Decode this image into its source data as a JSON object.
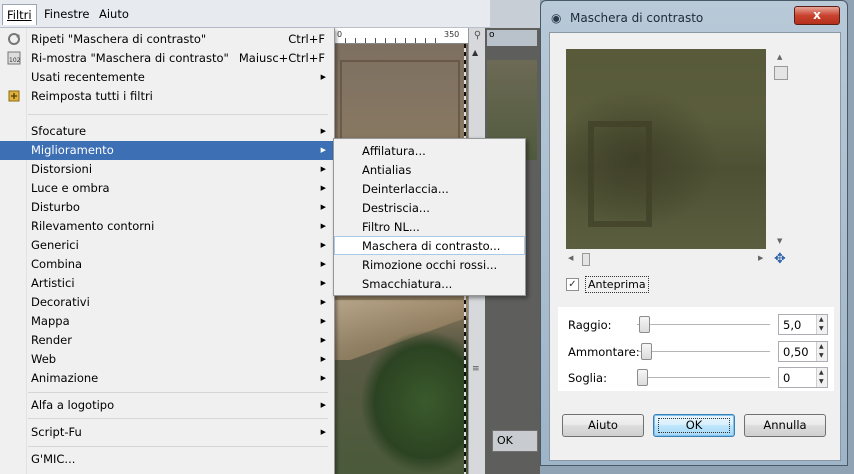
{
  "menubar": {
    "items": [
      "Filtri",
      "Finestre",
      "Aiuto"
    ]
  },
  "ruler": {
    "labels": [
      "0",
      "350"
    ]
  },
  "background_window": {
    "tab_label": "o",
    "ok_label": "OK"
  },
  "filtri_menu": {
    "items": [
      {
        "label": "Ripeti \"Maschera di contrasto\"",
        "accel": "Ctrl+F",
        "icon": "repeat-icon"
      },
      {
        "label": "Ri-mostra \"Maschera di contrasto\"",
        "accel": "Maiusc+Ctrl+F",
        "icon": "reshow-icon"
      },
      {
        "label": "Usati recentemente",
        "submenu": true
      },
      {
        "label": "Reimposta tutti i filtri",
        "icon": "reset-filters-icon"
      },
      {
        "label": "Sfocature",
        "submenu": true
      },
      {
        "label": "Miglioramento",
        "submenu": true,
        "selected": true
      },
      {
        "label": "Distorsioni",
        "submenu": true
      },
      {
        "label": "Luce e ombra",
        "submenu": true
      },
      {
        "label": "Disturbo",
        "submenu": true
      },
      {
        "label": "Rilevamento contorni",
        "submenu": true
      },
      {
        "label": "Generici",
        "submenu": true
      },
      {
        "label": "Combina",
        "submenu": true
      },
      {
        "label": "Artistici",
        "submenu": true
      },
      {
        "label": "Decorativi",
        "submenu": true
      },
      {
        "label": "Mappa",
        "submenu": true
      },
      {
        "label": "Render",
        "submenu": true
      },
      {
        "label": "Web",
        "submenu": true
      },
      {
        "label": "Animazione",
        "submenu": true
      },
      {
        "label": "Alfa a logotipo",
        "submenu": true
      },
      {
        "label": "Script-Fu",
        "submenu": true
      },
      {
        "label": "G'MIC..."
      }
    ]
  },
  "miglioramento_submenu": {
    "items": [
      "Affilatura...",
      "Antialias",
      "Deinterlaccia...",
      "Destriscia...",
      "Filtro NL...",
      "Maschera di contrasto...",
      "Rimozione occhi rossi...",
      "Smacchiatura..."
    ],
    "highlighted": "Maschera di contrasto..."
  },
  "dialog": {
    "title": "Maschera di contrasto",
    "close_label": "x",
    "preview_checkbox": {
      "label": "Anteprima",
      "checked": true
    },
    "params": [
      {
        "label": "Raggio:",
        "value": "5,0",
        "level": 0.02
      },
      {
        "label": "Ammontare:",
        "value": "0,50",
        "level": 0.03
      },
      {
        "label": "Soglia:",
        "value": "0",
        "level": 0.0
      }
    ],
    "buttons": {
      "help": "Aiuto",
      "ok": "OK",
      "cancel": "Annulla"
    }
  },
  "colors": {
    "menu_selection": "#3d6fb5",
    "submenu_highlight_border": "#aac8e8",
    "dialog_frame": "#9eb4c7",
    "close_button": "#c8422e"
  }
}
